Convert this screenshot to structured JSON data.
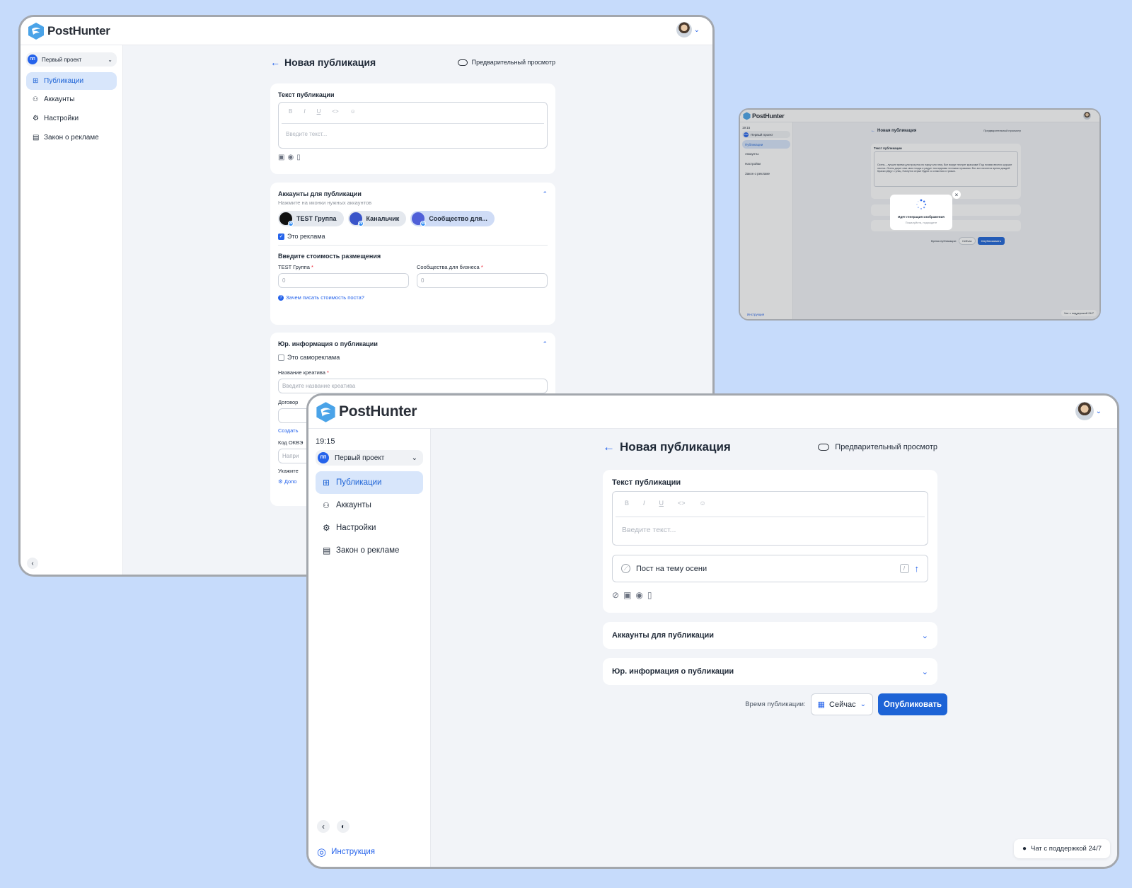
{
  "app": {
    "name": "PostHunter",
    "time": "19:15"
  },
  "project": {
    "badge": "ПП",
    "name": "Первый проект"
  },
  "nav": [
    {
      "label": "Публикации",
      "icon": "grid-icon",
      "active": true
    },
    {
      "label": "Аккаунты",
      "icon": "users-icon"
    },
    {
      "label": "Настройки",
      "icon": "gear-icon"
    },
    {
      "label": "Закон о рекламе",
      "icon": "document-icon"
    }
  ],
  "page": {
    "title": "Новая публикация",
    "preview_toggle": "Предварительный просмотр"
  },
  "editor": {
    "section_title": "Текст публикации",
    "placeholder": "Введите текст...",
    "toolbar": [
      "B",
      "I",
      "U",
      "<>",
      "☺"
    ]
  },
  "ai": {
    "prompt_value": "Пост на тему осени"
  },
  "accounts": {
    "title": "Аккаунты для публикации",
    "hint": "Нажмите на иконки нужных аккаунтов",
    "chips": [
      "TEST Группа",
      "Канальчик",
      "Сообщество для..."
    ],
    "ad_checkbox": "Это реклама",
    "cost_title": "Введите стоимость размещения",
    "cost_fields": [
      {
        "label": "TEST Группа",
        "value": "0"
      },
      {
        "label": "Сообщества для бизнеса",
        "value": "0"
      }
    ],
    "cost_help": "Зачем писать стоимость поста?"
  },
  "legal": {
    "title": "Юр. информация о публикации",
    "self_ad": "Это самореклама",
    "creative_label": "Название креатива",
    "creative_placeholder": "Введите название креатива",
    "contract_label": "Договор",
    "create_link": "Создать",
    "okved_label": "Код ОКВЭ",
    "okved_placeholder": "Напри",
    "specify": "Укажите",
    "more": "Допо"
  },
  "publish": {
    "time_label": "Время публикации:",
    "time_value": "Сейчас",
    "button": "Опубликовать"
  },
  "footer": {
    "instruction": "Инструкция",
    "support_chat": "Чат с поддержкой 24/7"
  },
  "overlay": {
    "post_text": "Осень – лучшее время для прогулок по парку или лесу. Все вокруг пестрит красками! Под ногами весело шуршат листья. Осень дарит нам свои плоды и радует последними теплыми лучиками. Вот-вот начнется время дождей. Краски уйдут с улиц. Начнутся серые будни со слякотью и грязью.",
    "loading_title": "Идёт генерация изображения",
    "loading_sub": "Пожалуйста, подождите"
  },
  "colors": {
    "accent": "#1d63d6",
    "background": "#c6dbfb",
    "active_nav": "#d8e6fb"
  }
}
